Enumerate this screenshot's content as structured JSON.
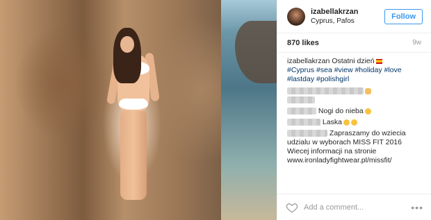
{
  "post": {
    "username": "izabellakrzan",
    "location": "Cyprus, Pafos",
    "follow_label": "Follow",
    "likes": "870 likes",
    "time": "9w",
    "caption_user": "izabellakrzan",
    "caption_text": "Ostatni dzień",
    "hashtags": "#Cyprus #sea #view #holiday #love #lastday #polishgirl",
    "comments": [
      {
        "text": ""
      },
      {
        "text": "Nogi do nieba"
      },
      {
        "text": "Laska"
      },
      {
        "user_visible": "z",
        "text": "Zapraszamy do wziecia udzialu w wyborach MISS FIT 2016 Wiecej informacji na stronie www.ironladyfightwear.pl/missfit/"
      }
    ],
    "add_comment_placeholder": "Add a comment...",
    "more_label": "•••"
  }
}
